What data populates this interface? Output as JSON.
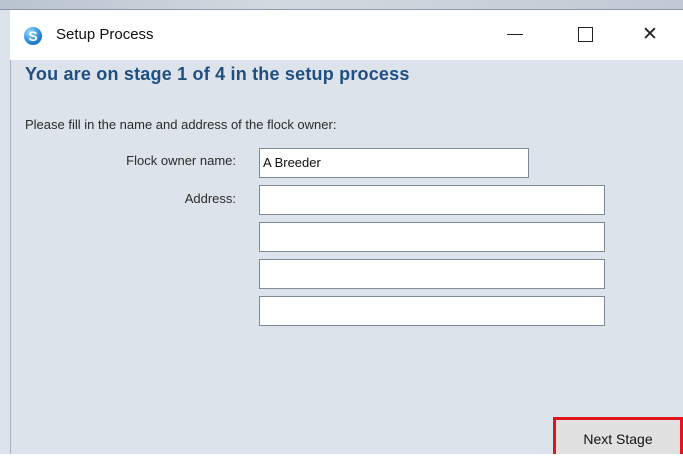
{
  "window": {
    "title": "Setup Process",
    "app_icon_letter": "S",
    "minimize_icon": "minimize-icon",
    "maximize_icon": "maximize-icon",
    "close_glyph": "✕"
  },
  "stage": {
    "heading": "You are on stage 1 of 4 in the setup process",
    "instructions": "Please fill in the name and address of the flock owner:"
  },
  "form": {
    "owner_name_label": "Flock owner name:",
    "owner_name_value": "A Breeder",
    "address_label": "Address:",
    "address_lines": [
      "",
      "",
      "",
      ""
    ]
  },
  "actions": {
    "next_label": "Next Stage"
  },
  "colors": {
    "heading": "#1f4f82",
    "background": "#dde3ea",
    "highlight": "#e0141b"
  }
}
